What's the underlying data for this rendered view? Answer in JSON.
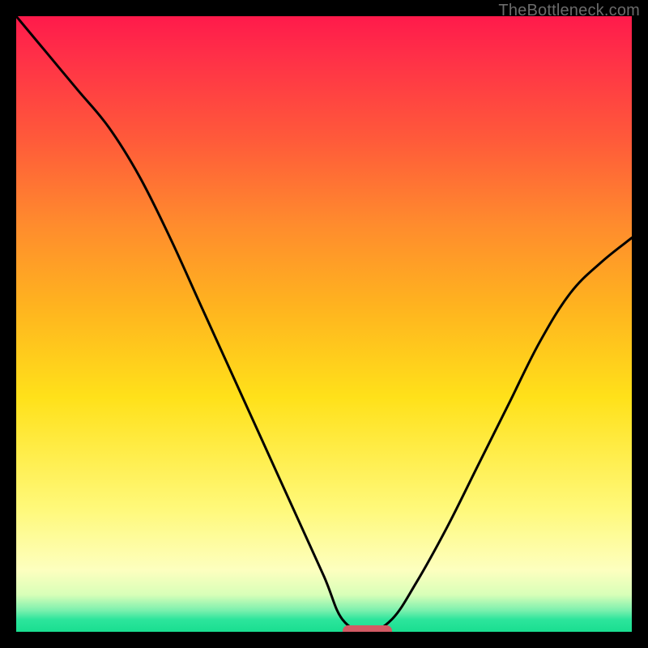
{
  "watermark": "TheBottleneck.com",
  "colors": {
    "frame": "#000000",
    "pill": "#d35b64",
    "curve": "#000000",
    "gradient_stops": [
      "#ff1a4b",
      "#ff2e48",
      "#ff5a3a",
      "#ff8c2d",
      "#ffb31f",
      "#ffe11a",
      "#fff97a",
      "#fdffbf",
      "#d8ffb8",
      "#7cf0ae",
      "#2de59c",
      "#19de90"
    ]
  },
  "chart_data": {
    "type": "line",
    "title": "",
    "xlabel": "",
    "ylabel": "",
    "xlim": [
      0,
      100
    ],
    "ylim": [
      0,
      100
    ],
    "annotations": [
      "TheBottleneck.com"
    ],
    "pill_marker": {
      "x_start": 53,
      "x_end": 61,
      "y": 0
    },
    "series": [
      {
        "name": "bottleneck-curve",
        "x": [
          0,
          5,
          10,
          15,
          20,
          25,
          30,
          35,
          40,
          45,
          50,
          53,
          57,
          61,
          65,
          70,
          75,
          80,
          85,
          90,
          95,
          100
        ],
        "values": [
          100,
          94,
          88,
          82,
          74,
          64,
          53,
          42,
          31,
          20,
          9,
          2,
          0,
          2,
          8,
          17,
          27,
          37,
          47,
          55,
          60,
          64
        ]
      }
    ]
  }
}
